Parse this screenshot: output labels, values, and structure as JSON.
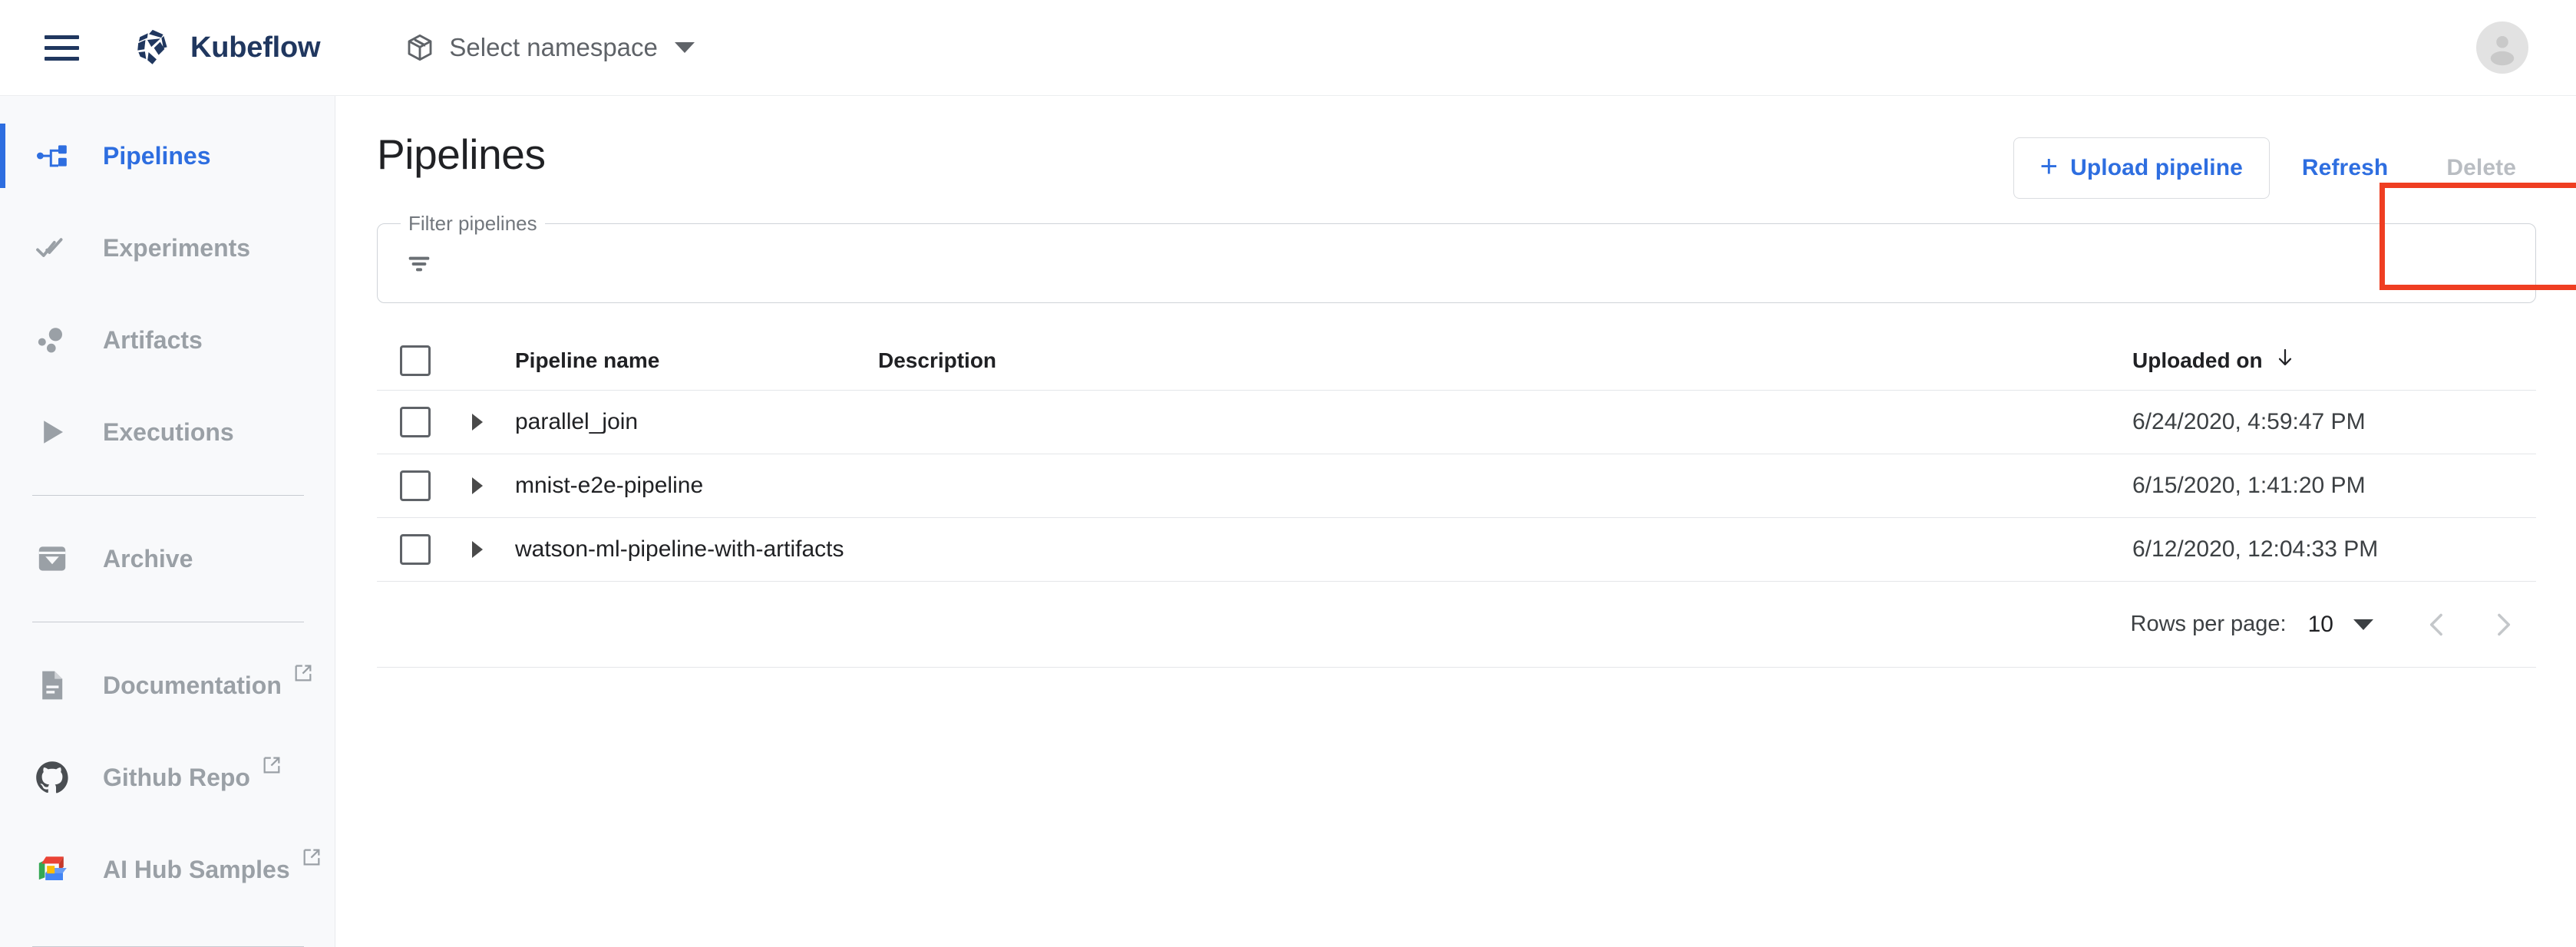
{
  "topbar": {
    "menu_icon": "hamburger-menu-icon",
    "brand_name": "Kubeflow",
    "brand_logo_icon": "kubeflow-logo-icon",
    "namespace_icon": "package-cube-icon",
    "namespace_label": "Select namespace",
    "namespace_caret_icon": "chevron-down-icon",
    "avatar_icon": "account-circle-icon"
  },
  "sidebar": {
    "items": [
      {
        "label": "Pipelines",
        "icon": "device-hub-icon",
        "active": true,
        "external": false
      },
      {
        "label": "Experiments",
        "icon": "double-check-icon",
        "active": false,
        "external": false
      },
      {
        "label": "Artifacts",
        "icon": "bubble-chart-icon",
        "active": false,
        "external": false
      },
      {
        "label": "Executions",
        "icon": "play-triangle-icon",
        "active": false,
        "external": false
      },
      {
        "label": "Archive",
        "icon": "archive-box-icon",
        "active": false,
        "external": false
      },
      {
        "label": "Documentation",
        "icon": "document-icon",
        "active": false,
        "external": true
      },
      {
        "label": "Github Repo",
        "icon": "github-icon",
        "active": false,
        "external": true
      },
      {
        "label": "AI Hub Samples",
        "icon": "ai-hub-cubes-icon",
        "active": false,
        "external": true
      }
    ]
  },
  "page": {
    "title": "Pipelines"
  },
  "toolbar": {
    "upload_label": "Upload pipeline",
    "upload_plus": "+",
    "refresh_label": "Refresh",
    "delete_label": "Delete",
    "delete_disabled": true,
    "annotation_color": "#ef3e22",
    "accent_color": "#2e6ee0"
  },
  "filter": {
    "legend": "Filter pipelines",
    "value": "",
    "placeholder": "",
    "icon": "filter-list-icon"
  },
  "table": {
    "columns": [
      {
        "key": "name",
        "label": "Pipeline name"
      },
      {
        "key": "description",
        "label": "Description"
      },
      {
        "key": "uploaded_on",
        "label": "Uploaded on",
        "sort": "desc",
        "sort_icon": "arrow-down-icon"
      }
    ],
    "select_all_checked": false,
    "rows": [
      {
        "name": "parallel_join",
        "description": "",
        "uploaded_on": "6/24/2020, 4:59:47 PM",
        "checked": false
      },
      {
        "name": "mnist-e2e-pipeline",
        "description": "",
        "uploaded_on": "6/15/2020, 1:41:20 PM",
        "checked": false
      },
      {
        "name": "watson-ml-pipeline-with-artifacts",
        "description": "",
        "uploaded_on": "6/12/2020, 12:04:33 PM",
        "checked": false
      }
    ]
  },
  "pagination": {
    "rows_per_page_label": "Rows per page:",
    "rows_per_page_value": "10",
    "prev_icon": "chevron-left-icon",
    "next_icon": "chevron-right-icon",
    "prev_disabled": true,
    "next_disabled": true
  }
}
